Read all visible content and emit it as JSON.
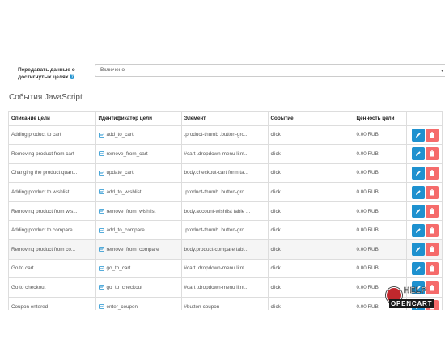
{
  "setting": {
    "label": "Передавать данные о достигнутых целях",
    "help_glyph": "?",
    "value": "Включено"
  },
  "section_title": "События JavaScript",
  "columns": [
    "Описание цели",
    "Идентификатор цели",
    "Элемент",
    "Событие",
    "Ценность цели",
    ""
  ],
  "rows": [
    {
      "desc": "Adding product to cart",
      "id": "add_to_cart",
      "element": ".product-thumb .button-gro...",
      "event": "click",
      "value": "0.00 RUB"
    },
    {
      "desc": "Removing product from cart",
      "id": "remove_from_cart",
      "element": "#cart .dropdown-menu li:nt...",
      "event": "click",
      "value": "0.00 RUB"
    },
    {
      "desc": "Changing the product quan...",
      "id": "update_cart",
      "element": "body.checkout-cart form ta...",
      "event": "click",
      "value": "0.00 RUB"
    },
    {
      "desc": "Adding product to wishlist",
      "id": "add_to_wishlist",
      "element": ".product-thumb .button-gro...",
      "event": "click",
      "value": "0.00 RUB"
    },
    {
      "desc": "Removing product from wis...",
      "id": "remove_from_wishlist",
      "element": "body.account-wishlist table ...",
      "event": "click",
      "value": "0.00 RUB"
    },
    {
      "desc": "Adding product to compare",
      "id": "add_to_compare",
      "element": ".product-thumb .button-gro...",
      "event": "click",
      "value": "0.00 RUB"
    },
    {
      "desc": "Removing product from co...",
      "id": "remove_from_compare",
      "element": "body.product-compare tabl...",
      "event": "click",
      "value": "0.00 RUB"
    },
    {
      "desc": "Go to cart",
      "id": "go_to_cart",
      "element": "#cart .dropdown-menu li:nt...",
      "event": "click",
      "value": "0.00 RUB"
    },
    {
      "desc": "Go to checkout",
      "id": "go_to_checkout",
      "element": "#cart .dropdown-menu li:nt...",
      "event": "click",
      "value": "0.00 RUB"
    },
    {
      "desc": "Coupon entered",
      "id": "enter_coupon",
      "element": "#button-coupon",
      "event": "click",
      "value": "0.00 RUB"
    }
  ],
  "highlighted_row": 6,
  "logo": {
    "top": "HELP",
    "bottom": "OPENCART"
  },
  "colors": {
    "edit": "#1e91cf",
    "delete": "#f56b6b",
    "logo_red": "#c0282d"
  }
}
